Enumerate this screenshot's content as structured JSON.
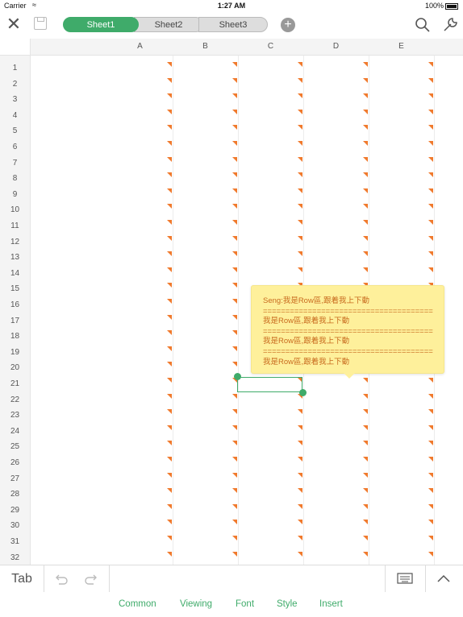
{
  "status_bar": {
    "carrier": "Carrier",
    "time": "1:27 AM",
    "battery": "100%"
  },
  "toolbar": {
    "close_icon": "close-icon",
    "save_icon": "save-icon",
    "sheets": [
      "Sheet1",
      "Sheet2",
      "Sheet3"
    ],
    "active_sheet": "Sheet1",
    "add_icon": "plus-icon",
    "search_icon": "search-icon",
    "tools_icon": "wrench-icon"
  },
  "columns": [
    "A",
    "B",
    "C",
    "D",
    "E"
  ],
  "rows": [
    "1",
    "2",
    "3",
    "4",
    "5",
    "6",
    "7",
    "8",
    "9",
    "10",
    "11",
    "12",
    "13",
    "14",
    "15",
    "16",
    "17",
    "18",
    "19",
    "20",
    "21",
    "22",
    "23",
    "24",
    "25",
    "26",
    "27",
    "28",
    "29",
    "30",
    "31",
    "32"
  ],
  "comment": {
    "text": "Seng:我是Row區,跟着我上下動\n======================================我是Row區,跟着我上下動\n======================================我是Row區,跟着我上下動\n======================================我是Row區,跟着我上下動"
  },
  "bottom_bar": {
    "tab_label": "Tab",
    "undo_icon": "undo-icon",
    "redo_icon": "redo-icon",
    "keyboard_icon": "keyboard-icon",
    "collapse_icon": "chevron-up-icon"
  },
  "menu": [
    "Common",
    "Viewing",
    "Font",
    "Style",
    "Insert"
  ],
  "colors": {
    "accent": "#3fab6a",
    "comment_bg": "#fef09b",
    "comment_text": "#c86a1e",
    "flag": "#f07a2d"
  }
}
